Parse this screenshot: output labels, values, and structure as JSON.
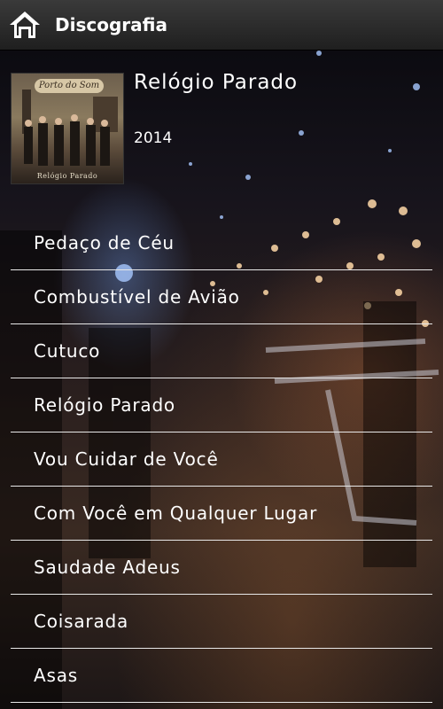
{
  "header": {
    "title": "Discografia",
    "home_icon": "home-icon"
  },
  "album": {
    "title": "Relógio Parado",
    "year": "2014",
    "cover_logo": "Porto do Som",
    "cover_subtitle": "Relógio Parado"
  },
  "tracks": [
    {
      "label": "Pedaço de Céu"
    },
    {
      "label": "Combustível de Avião"
    },
    {
      "label": "Cutuco"
    },
    {
      "label": "Relógio Parado"
    },
    {
      "label": "Vou Cuidar de Você"
    },
    {
      "label": "Com Você em Qualquer Lugar"
    },
    {
      "label": "Saudade Adeus"
    },
    {
      "label": "Coisarada"
    },
    {
      "label": "Asas"
    }
  ]
}
